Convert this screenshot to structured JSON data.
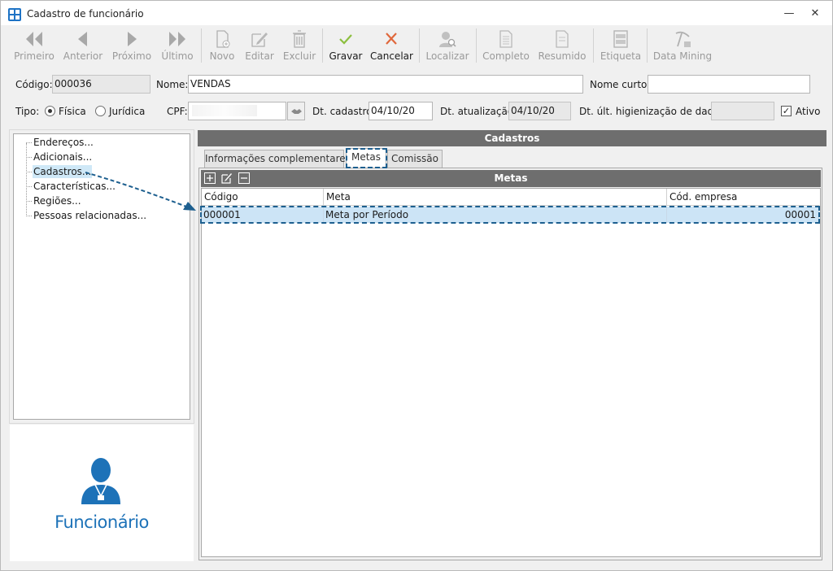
{
  "window": {
    "title": "Cadastro de funcionário"
  },
  "toolbar": {
    "first": "Primeiro",
    "previous": "Anterior",
    "next": "Próximo",
    "last": "Último",
    "new": "Novo",
    "edit": "Editar",
    "delete": "Excluir",
    "save": "Gravar",
    "cancel": "Cancelar",
    "find": "Localizar",
    "complete": "Completo",
    "summary": "Resumido",
    "label": "Etiqueta",
    "data_mining": "Data Mining"
  },
  "form": {
    "codigo_label": "Código:",
    "codigo_value": "000036",
    "nome_label": "Nome:",
    "nome_value": "VENDAS",
    "nome_curto_label": "Nome curto:",
    "nome_curto_value": "",
    "tipo_label": "Tipo:",
    "fisica_label": "Física",
    "juridica_label": "Jurídica",
    "tipo_selected": "Física",
    "cpf_label": "CPF:",
    "dt_cadastro_label": "Dt. cadastro:",
    "dt_cadastro_value": "04/10/20",
    "dt_atualizacao_label": "Dt. atualização:",
    "dt_atualizacao_value": "04/10/20",
    "dt_higienizacao_label": "Dt. últ. higienização de dados:",
    "dt_higienizacao_value": "",
    "ativo_label": "Ativo",
    "ativo_checked": true
  },
  "tree": {
    "items": [
      {
        "label": "Endereços..."
      },
      {
        "label": "Adicionais..."
      },
      {
        "label": "Cadastros...",
        "selected": true
      },
      {
        "label": "Características..."
      },
      {
        "label": "Regiões..."
      },
      {
        "label": "Pessoas relacionadas..."
      }
    ]
  },
  "photo": {
    "caption": "Funcionário"
  },
  "main": {
    "section_title": "Cadastros",
    "tabs": [
      {
        "label": "Informações complementares"
      },
      {
        "label": "Metas",
        "active": true
      },
      {
        "label": "Comissão"
      }
    ],
    "grid_title": "Metas",
    "columns": [
      "Código",
      "Meta",
      "Cód. empresa"
    ],
    "rows": [
      [
        "000001",
        "Meta por Período",
        "00001"
      ]
    ]
  },
  "colors": {
    "accent": "#1d72b8",
    "header_bar": "#6e6e6e",
    "selection": "#cce4f6",
    "annotation": "#1d5f8f"
  }
}
